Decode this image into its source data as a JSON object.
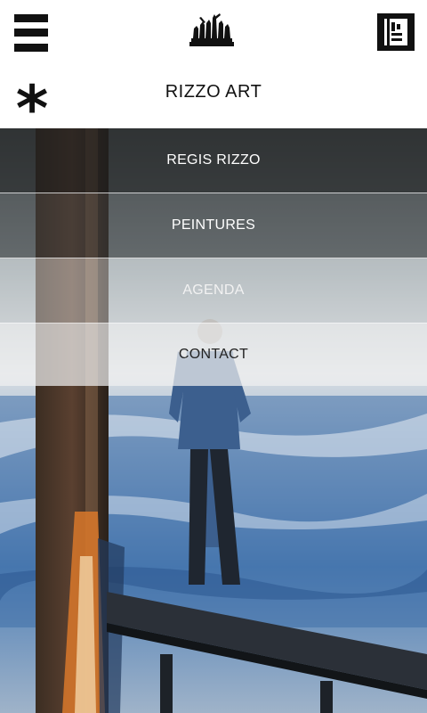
{
  "header": {
    "menu_icon": "hamburger-menu-icon",
    "logo_icon": "statue-group-logo",
    "book_icon": "book-icon",
    "asterisk_icon": "asterisk-icon",
    "asterisk_glyph": "*",
    "title": "RIZZO ART"
  },
  "menu": {
    "items": [
      {
        "label": "REGIS RIZZO"
      },
      {
        "label": "PEINTURES"
      },
      {
        "label": "AGENDA"
      },
      {
        "label": "CONTACT"
      }
    ]
  },
  "colors": {
    "header_bg": "#ffffff",
    "icon_dark": "#111111",
    "water_blue": "#2f5f9e",
    "pier_orange": "#d9782a"
  }
}
